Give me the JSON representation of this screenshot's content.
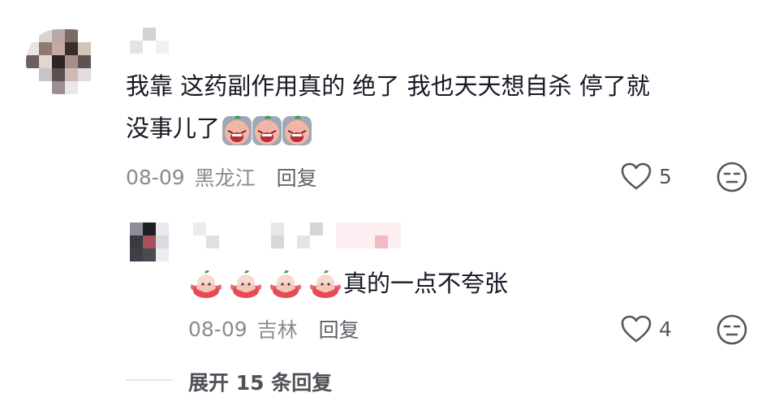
{
  "comment": {
    "text_line1": "我靠 这药副作用真的 绝了 我也天天想自杀 停了就",
    "text_line2": "没事儿了",
    "emojis": [
      "crying-face-emoji",
      "crying-face-emoji",
      "crying-face-emoji"
    ],
    "date": "08-09",
    "location": "黑龙江",
    "reply_label": "回复",
    "like_count": "5",
    "avatar_colors": [
      "#ffffff",
      "#d8d3d3",
      "#b9a8a8",
      "#7d6a66",
      "#ffffff",
      "#ffffff",
      "#e9e4e6",
      "#8e7a72",
      "#c6a7a1",
      "#3a2e2b",
      "#d1c4b9",
      "#ffffff",
      "#6f5f5c",
      "#e6d4d2",
      "#2d2421",
      "#a88e89",
      "#5e5352",
      "#ffffff",
      "#ffffff",
      "#c9c3c6",
      "#5a5052",
      "#cfbbb6",
      "#e2dce0",
      "#ffffff",
      "#ffffff",
      "#ffffff",
      "#9b8f95",
      "#ece6e8",
      "#ffffff",
      "#ffffff"
    ]
  },
  "reply": {
    "text": "真的一点不夸张",
    "emojis": [
      "peach-bun-emoji",
      "peach-bun-emoji",
      "peach-bun-emoji",
      "peach-bun-emoji"
    ],
    "date": "08-09",
    "location": "吉林",
    "reply_label": "回复",
    "like_count": "4",
    "avatar_colors": [
      "#8b8e96",
      "#1f2025",
      "#e9e9ee",
      "#3b3a3f",
      "#a84f5e",
      "#dadbe2",
      "#3e4047",
      "#4a4b52",
      "#eeeeef"
    ]
  },
  "expand": {
    "label": "展开 15 条回复"
  },
  "colors": {
    "meta_gray": "#8a8b91",
    "text_dark": "#161823",
    "icon_gray": "#55565c"
  }
}
